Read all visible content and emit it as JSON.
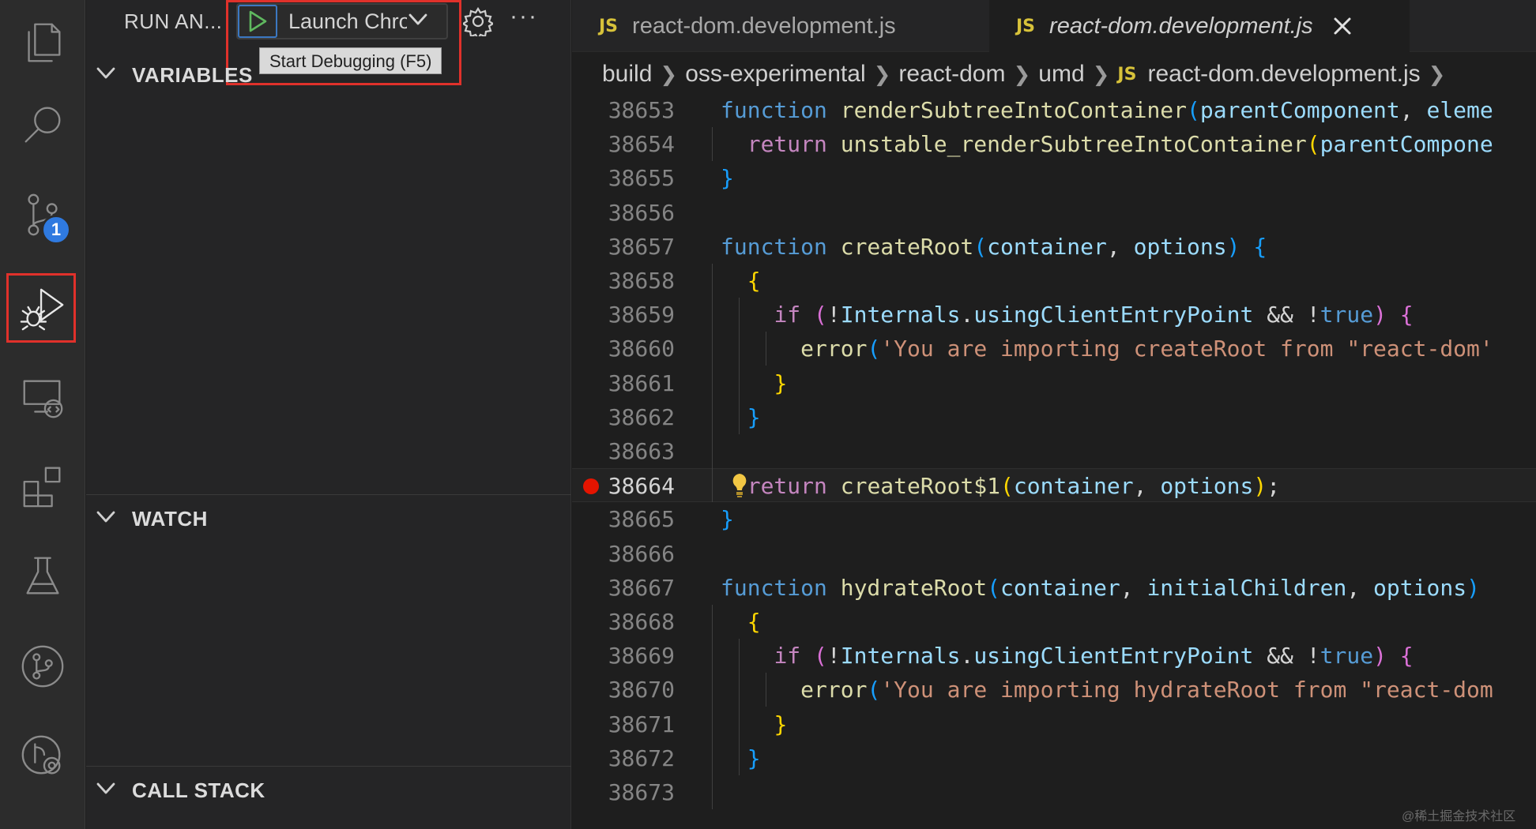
{
  "activity_bar": {
    "items": [
      {
        "name": "explorer-icon",
        "active": false
      },
      {
        "name": "search-icon",
        "active": false
      },
      {
        "name": "source-control-icon",
        "active": false
      },
      {
        "name": "run-and-debug-icon",
        "active": true
      },
      {
        "name": "remote-explorer-icon",
        "active": false
      },
      {
        "name": "extensions-icon",
        "active": false
      },
      {
        "name": "testing-icon",
        "active": false
      },
      {
        "name": "git-graph-icon",
        "active": false
      },
      {
        "name": "git-lens-icon",
        "active": false
      }
    ],
    "source_control_badge": "1"
  },
  "sidebar": {
    "title": "RUN AN...",
    "launch_config": "Launch Chrome",
    "tooltip": "Start Debugging (F5)",
    "sections": {
      "variables": "VARIABLES",
      "watch": "WATCH",
      "call_stack": "CALL STACK"
    }
  },
  "tabs": [
    {
      "label": "react-dom.development.js",
      "active": false,
      "icon": "JS"
    },
    {
      "label": "react-dom.development.js",
      "active": true,
      "icon": "JS"
    }
  ],
  "breadcrumb": {
    "parts": [
      "build",
      "oss-experimental",
      "react-dom",
      "umd"
    ],
    "file": "react-dom.development.js",
    "file_icon": "JS"
  },
  "editor": {
    "breakpoint_line": 38664,
    "current_line": 38664,
    "lines": [
      {
        "n": "38653",
        "text": "function renderSubtreeIntoContainer(parentComponent, eleme"
      },
      {
        "n": "38654",
        "text": "  return unstable_renderSubtreeIntoContainer(parentCompone"
      },
      {
        "n": "38655",
        "text": "}"
      },
      {
        "n": "38656",
        "text": ""
      },
      {
        "n": "38657",
        "text": "function createRoot(container, options) {"
      },
      {
        "n": "38658",
        "text": "  {"
      },
      {
        "n": "38659",
        "text": "    if (!Internals.usingClientEntryPoint && !true) {"
      },
      {
        "n": "38660",
        "text": "      error('You are importing createRoot from \"react-dom'"
      },
      {
        "n": "38661",
        "text": "    }"
      },
      {
        "n": "38662",
        "text": "  }"
      },
      {
        "n": "38663",
        "text": ""
      },
      {
        "n": "38664",
        "text": "  return createRoot$1(container, options);"
      },
      {
        "n": "38665",
        "text": "}"
      },
      {
        "n": "38666",
        "text": ""
      },
      {
        "n": "38667",
        "text": "function hydrateRoot(container, initialChildren, options)"
      },
      {
        "n": "38668",
        "text": "  {"
      },
      {
        "n": "38669",
        "text": "    if (!Internals.usingClientEntryPoint && !true) {"
      },
      {
        "n": "38670",
        "text": "      error('You are importing hydrateRoot from \"react-dom"
      },
      {
        "n": "38671",
        "text": "    }"
      },
      {
        "n": "38672",
        "text": "  }"
      },
      {
        "n": "38673",
        "text": ""
      }
    ]
  },
  "watermark": "@稀土掘金技术社区",
  "colors": {
    "highlight_box": "#e0312b",
    "badge": "#2f7ae0",
    "breakpoint": "#e51400",
    "js_icon": "#d7c23a"
  }
}
